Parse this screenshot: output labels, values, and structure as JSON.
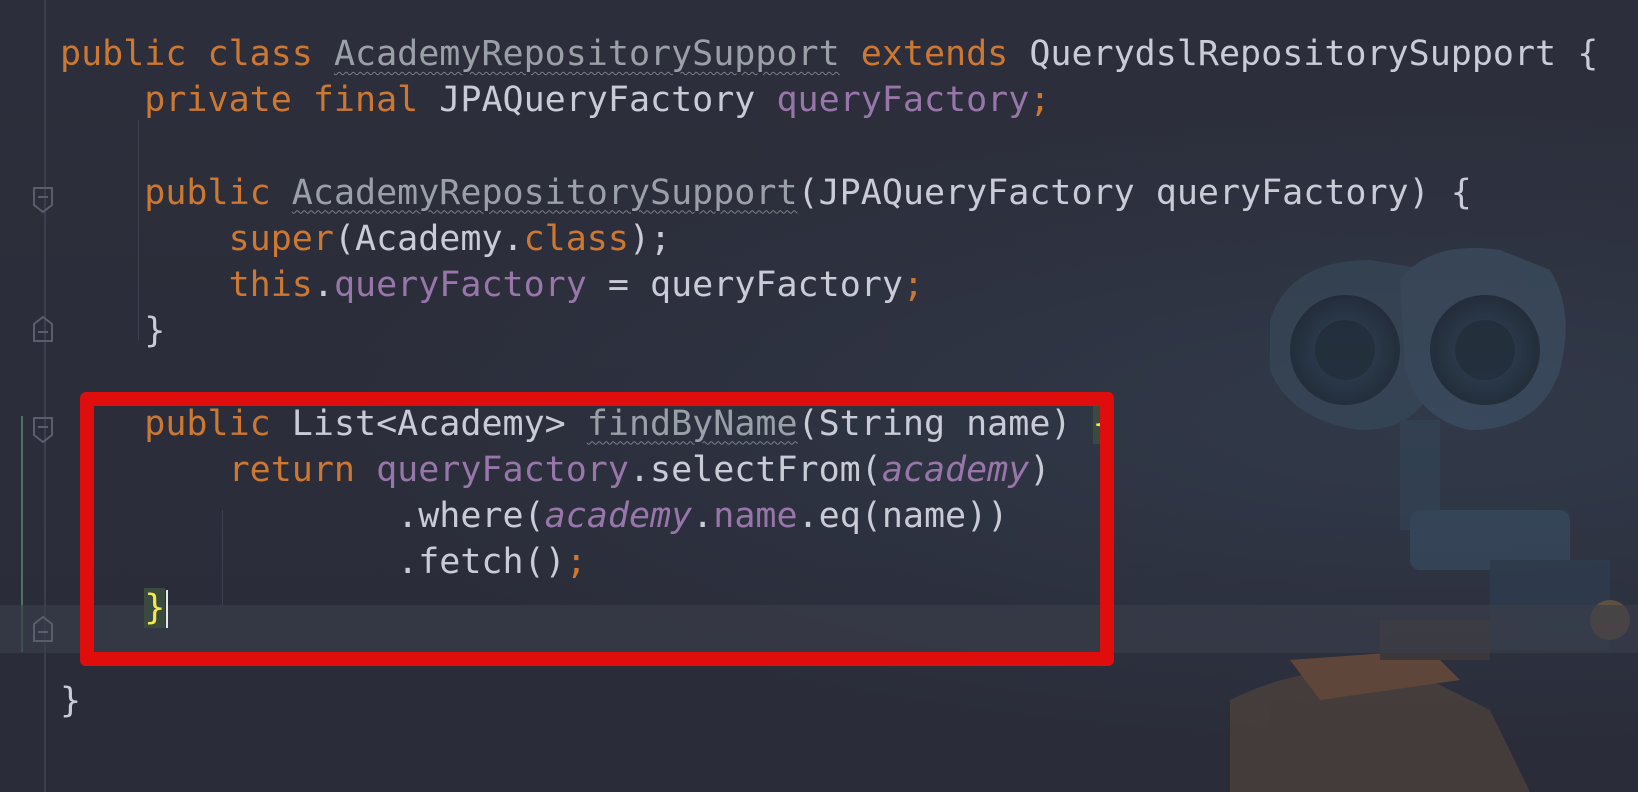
{
  "editor": {
    "colors": {
      "background": "#2b2d3a",
      "keyword": "#cc7832",
      "text": "#c9ccd7",
      "field": "#9876aa",
      "brace_highlight": "#f2e94e",
      "highlight_box": "#e00d0d"
    },
    "lines": [
      {
        "tokens": [
          {
            "t": "public class ",
            "k": "kw"
          },
          {
            "t": "AcademyRepositorySupport",
            "k": "unused"
          },
          {
            "t": " extends ",
            "k": "kw"
          },
          {
            "t": "QuerydslRepositorySupport {",
            "k": "plain"
          }
        ]
      },
      {
        "tokens": [
          {
            "t": "    private final ",
            "k": "kw"
          },
          {
            "t": "JPAQueryFactory ",
            "k": "plain"
          },
          {
            "t": "queryFactory",
            "k": "field"
          },
          {
            "t": ";",
            "k": "kw"
          }
        ]
      },
      {
        "tokens": []
      },
      {
        "tokens": [
          {
            "t": "    public ",
            "k": "kw"
          },
          {
            "t": "AcademyRepositorySupport",
            "k": "unused"
          },
          {
            "t": "(JPAQueryFactory queryFactory) {",
            "k": "plain"
          }
        ]
      },
      {
        "tokens": [
          {
            "t": "        super",
            "k": "kw"
          },
          {
            "t": "(Academy.",
            "k": "plain"
          },
          {
            "t": "class",
            "k": "kw"
          },
          {
            "t": ");",
            "k": "plain"
          }
        ]
      },
      {
        "tokens": [
          {
            "t": "        this",
            "k": "kw"
          },
          {
            "t": ".",
            "k": "plain"
          },
          {
            "t": "queryFactory",
            "k": "field"
          },
          {
            "t": " = queryFactory",
            "k": "plain"
          },
          {
            "t": ";",
            "k": "kw"
          }
        ]
      },
      {
        "tokens": [
          {
            "t": "    }",
            "k": "plain"
          }
        ]
      },
      {
        "tokens": []
      },
      {
        "tokens": [
          {
            "t": "    public ",
            "k": "kw"
          },
          {
            "t": "List<Academy> ",
            "k": "plain"
          },
          {
            "t": "findByName",
            "k": "unused"
          },
          {
            "t": "(String name) ",
            "k": "plain"
          },
          {
            "t": "{",
            "k": "brace-hl"
          }
        ]
      },
      {
        "tokens": [
          {
            "t": "        return ",
            "k": "kw"
          },
          {
            "t": "queryFactory",
            "k": "field"
          },
          {
            "t": ".selectFrom(",
            "k": "plain"
          },
          {
            "t": "academy",
            "k": "ital"
          },
          {
            "t": ")",
            "k": "plain"
          }
        ]
      },
      {
        "tokens": [
          {
            "t": "                .where(",
            "k": "plain"
          },
          {
            "t": "academy",
            "k": "ital"
          },
          {
            "t": ".",
            "k": "plain"
          },
          {
            "t": "name",
            "k": "field"
          },
          {
            "t": ".eq(name))",
            "k": "plain"
          }
        ]
      },
      {
        "tokens": [
          {
            "t": "                .fetch()",
            "k": "plain"
          },
          {
            "t": ";",
            "k": "kw"
          }
        ]
      },
      {
        "tokens": [
          {
            "t": "    ",
            "k": "plain"
          },
          {
            "t": "}",
            "k": "brace-hl"
          }
        ],
        "caret": true
      },
      {
        "tokens": []
      },
      {
        "tokens": [
          {
            "t": "}",
            "k": "plain"
          }
        ]
      }
    ]
  }
}
